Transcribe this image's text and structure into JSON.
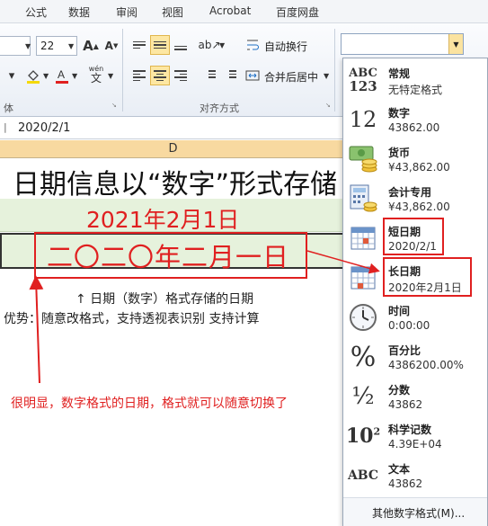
{
  "ribbon": {
    "tabs": [
      "公式",
      "数据",
      "审阅",
      "视图",
      "Acrobat",
      "百度网盘"
    ],
    "font_size": "22",
    "wrap_text_label": "自动换行",
    "merge_center_label": "合并后居中",
    "group_font_label_partial": "体",
    "group_alignment_label": "对齐方式",
    "number_format_value": ""
  },
  "formula_bar": {
    "value": "2020/2/1"
  },
  "sheet": {
    "column_header": "D",
    "title": "日期信息以“数字”形式存储",
    "date_display": "2021年2月1日",
    "chinese_date": "二〇二〇年二月一日",
    "note_line1": "↑ 日期（数字）格式存储的日期",
    "note_line2": "优势：随意改格式，支持透视表识别 支持计算",
    "annotation": "很明显，数字格式的日期，格式就可以随意切换了"
  },
  "number_formats": {
    "items": [
      {
        "name": "常规",
        "sample": "无特定格式",
        "icon": "abc-123-icon"
      },
      {
        "name": "数字",
        "sample": "43862.00",
        "icon": "number-12-icon"
      },
      {
        "name": "货币",
        "sample": "¥43,862.00",
        "icon": "currency-icon"
      },
      {
        "name": "会计专用",
        "sample": "¥43,862.00",
        "icon": "accounting-icon"
      },
      {
        "name": "短日期",
        "sample": "2020/2/1",
        "icon": "short-date-calendar-icon"
      },
      {
        "name": "长日期",
        "sample": "2020年2月1日",
        "icon": "long-date-calendar-icon"
      },
      {
        "name": "时间",
        "sample": "0:00:00",
        "icon": "clock-icon"
      },
      {
        "name": "百分比",
        "sample": "4386200.00%",
        "icon": "percent-icon"
      },
      {
        "name": "分数",
        "sample": "43862",
        "icon": "fraction-icon"
      },
      {
        "name": "科学记数",
        "sample": "4.39E+04",
        "icon": "scientific-icon"
      },
      {
        "name": "文本",
        "sample": "43862",
        "icon": "text-abc-icon"
      }
    ],
    "more_label": "其他数字格式(M)..."
  },
  "colors": {
    "annotation_red": "#e02020",
    "row_fill": "#e6f2dc",
    "column_header_fill": "#f8d9a0",
    "highlight_button": "#fde7a3"
  }
}
